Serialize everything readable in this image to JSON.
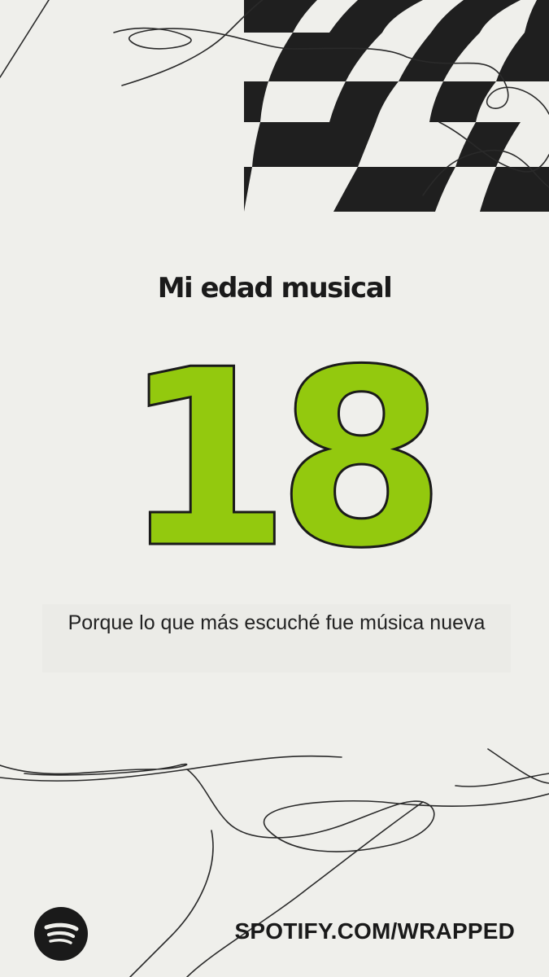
{
  "card": {
    "title": "Mi edad musical",
    "age": "18",
    "subtitle": "Porque lo que más escuché fue música nueva",
    "footer_url": "SPOTIFY.COM/WRAPPED"
  },
  "icons": {
    "logo": "spotify-logo-icon"
  },
  "colors": {
    "background": "#efefeb",
    "accent_green": "#93c90e",
    "ink": "#1a1a1a"
  }
}
